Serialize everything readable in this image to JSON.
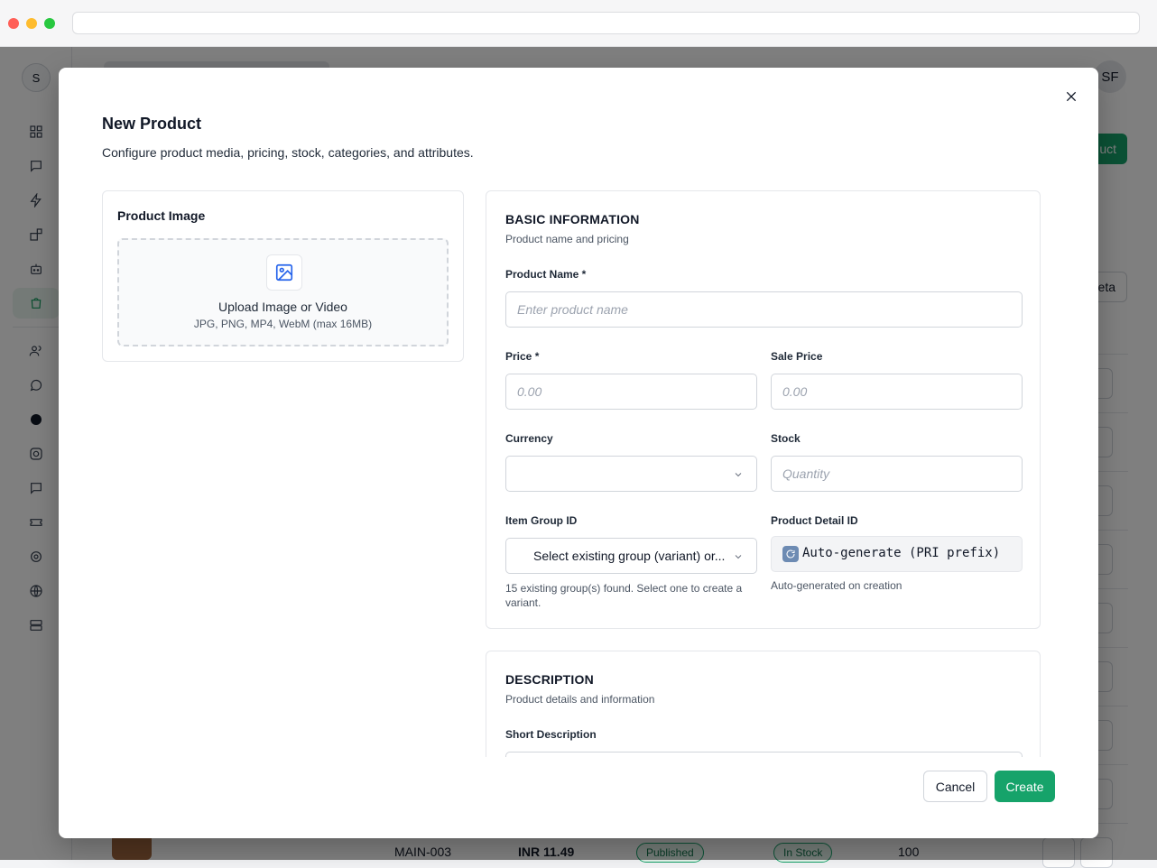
{
  "background": {
    "sidebar_avatar": "S",
    "user_avatar": "SF",
    "add_button_partial": "uct",
    "meta_button_partial": "eta",
    "last_row": {
      "sku": "MAIN-003",
      "price": "INR 11.49",
      "status": "Published",
      "stock_status": "In Stock",
      "stock": "100"
    }
  },
  "modal": {
    "title": "New Product",
    "subtitle": "Configure product media, pricing, stock, categories, and attributes.",
    "image_card": {
      "title": "Product Image",
      "upload_title": "Upload Image or Video",
      "upload_hint": "JPG, PNG, MP4, WebM (max 16MB)"
    },
    "basic": {
      "title": "BASIC INFORMATION",
      "subtitle": "Product name and pricing",
      "product_name_label": "Product Name *",
      "product_name_placeholder": "Enter product name",
      "price_label": "Price *",
      "price_placeholder": "0.00",
      "sale_price_label": "Sale Price",
      "sale_price_placeholder": "0.00",
      "currency_label": "Currency",
      "currency_value": "",
      "stock_label": "Stock",
      "stock_placeholder": "Quantity",
      "item_group_label": "Item Group ID",
      "item_group_value": "Select existing group (variant) or...",
      "item_group_help": "15 existing group(s) found. Select one to create a variant.",
      "detail_id_label": "Product Detail ID",
      "detail_id_value": "Auto-generate (PRI prefix)",
      "detail_id_help": "Auto-generated on creation"
    },
    "description": {
      "title": "DESCRIPTION",
      "subtitle": "Product details and information",
      "short_desc_label": "Short Description"
    },
    "footer": {
      "cancel": "Cancel",
      "create": "Create"
    }
  },
  "colors": {
    "primary": "#16a36a",
    "overlay": "rgba(0,0,0,0.5)"
  }
}
